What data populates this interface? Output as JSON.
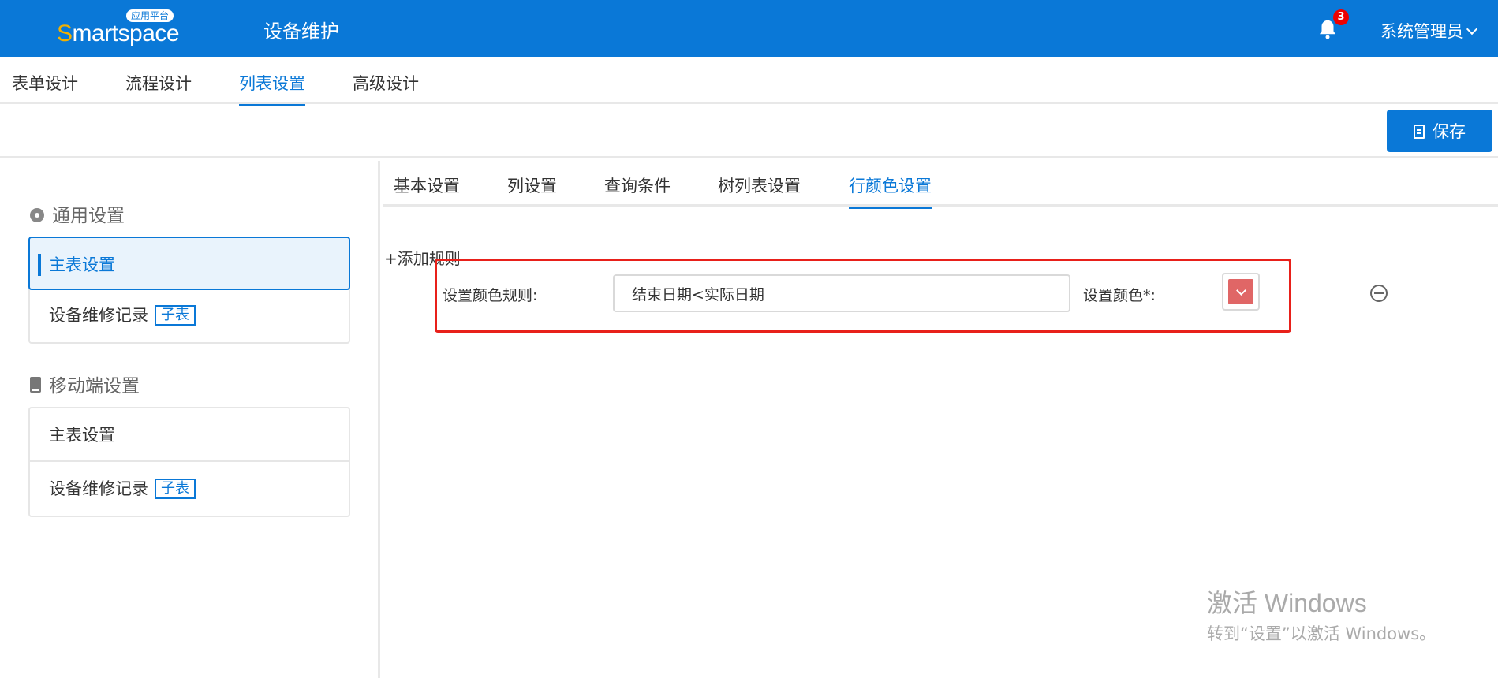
{
  "header": {
    "logo_text": "Smartspace",
    "logo_badge": "应用平台",
    "app_title": "设备维护",
    "notification_count": "3",
    "user_name": "系统管理员"
  },
  "main_tabs": [
    "表单设计",
    "流程设计",
    "列表设置",
    "高级设计"
  ],
  "toolbar": {
    "save_label": "保存"
  },
  "sidebar": {
    "general_title": "通用设置",
    "general_items": [
      {
        "label": "主表设置"
      },
      {
        "label": "设备维修记录",
        "tag": "子表"
      }
    ],
    "mobile_title": "移动端设置",
    "mobile_items": [
      {
        "label": "主表设置"
      },
      {
        "label": "设备维修记录",
        "tag": "子表"
      }
    ]
  },
  "sub_tabs": [
    "基本设置",
    "列设置",
    "查询条件",
    "树列表设置",
    "行颜色设置"
  ],
  "rule": {
    "add_label": "+添加规则",
    "color_rule_label": "设置颜色规则:",
    "color_rule_value": "结束日期<实际日期",
    "color_label": "设置颜色*:",
    "color_value": "#e06666"
  },
  "watermark": {
    "line1": "激活 Windows",
    "line2": "转到“设置”以激活 Windows。"
  }
}
